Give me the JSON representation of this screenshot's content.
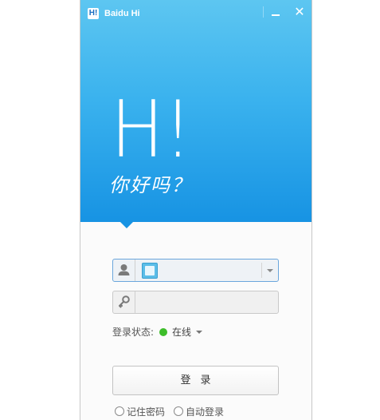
{
  "window": {
    "title": "Baidu Hi",
    "logo_text": "Hi!"
  },
  "hero": {
    "logo_text": "H!",
    "greeting": "你好吗？"
  },
  "login_form": {
    "account_value": "",
    "password_value": "",
    "status_label": "登录状态:",
    "status_value": "在线",
    "status_color": "#3dbd2a",
    "login_button": "登录",
    "remember_password": "记住密码",
    "auto_login": "自动登录"
  },
  "colors": {
    "header_top": "#5dc6f1",
    "header_bottom": "#1793e3"
  }
}
